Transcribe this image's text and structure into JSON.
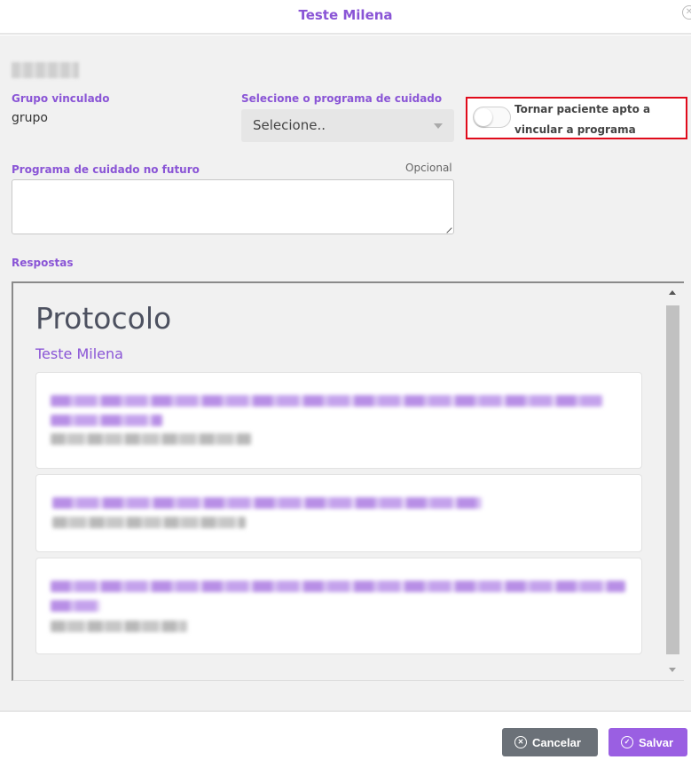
{
  "dialog": {
    "title": "Teste Milena"
  },
  "form": {
    "grupo_vinculado_label": "Grupo vinculado",
    "grupo_vinculado_value": "grupo",
    "programa_label": "Selecione o programa de cuidado",
    "programa_selected": "Selecione..",
    "toggle_label": "Tornar paciente apto a vincular a programa",
    "toggle_on": false,
    "futuro_label": "Programa de cuidado no futuro",
    "futuro_optional": "Opcional",
    "respostas_label": "Respostas"
  },
  "respostas": {
    "title": "Protocolo",
    "subtitle": "Teste Milena"
  },
  "footer": {
    "cancel_label": "Cancelar",
    "save_label": "Salvar"
  },
  "colors": {
    "accent": "#8a55d6",
    "save_button": "#9a5fe2",
    "cancel_button": "#6b7178",
    "highlight_border": "#e00b1b"
  },
  "icons": {
    "close": "close-circle-icon",
    "cancel": "x-circle-icon",
    "save": "check-circle-icon",
    "select_caret": "chevron-down-icon"
  }
}
